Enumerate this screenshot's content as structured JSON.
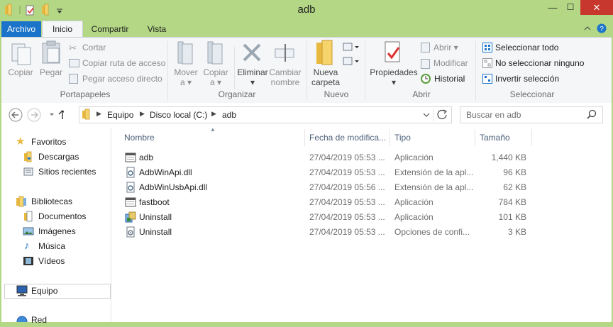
{
  "window": {
    "title": "adb",
    "minimize": "—",
    "close": "✕"
  },
  "tabs": {
    "archivo": "Archivo",
    "inicio": "Inicio",
    "compartir": "Compartir",
    "vista": "Vista"
  },
  "ribbon": {
    "portapapeles": {
      "label": "Portapapeles",
      "copiar": "Copiar",
      "pegar": "Pegar",
      "cortar": "Cortar",
      "copiar_ruta": "Copiar ruta de acceso",
      "pegar_acceso": "Pegar acceso directo"
    },
    "organizar": {
      "label": "Organizar",
      "mover_a": "Mover",
      "copiar_a": "Copiar",
      "a": "a",
      "eliminar": "Eliminar",
      "cambiar_nombre_1": "Cambiar",
      "cambiar_nombre_2": "nombre"
    },
    "nuevo": {
      "label": "Nuevo",
      "nueva_carpeta_1": "Nueva",
      "nueva_carpeta_2": "carpeta"
    },
    "abrir": {
      "label": "Abrir",
      "propiedades": "Propiedades",
      "abrir": "Abrir",
      "modificar": "Modificar",
      "historial": "Historial"
    },
    "seleccionar": {
      "label": "Seleccionar",
      "todo": "Seleccionar todo",
      "ninguno": "No seleccionar ninguno",
      "invertir": "Invertir selección"
    }
  },
  "address": {
    "crumbs": [
      "Equipo",
      "Disco local (C:)",
      "adb"
    ],
    "search_placeholder": "Buscar en adb"
  },
  "nav": {
    "favoritos": "Favoritos",
    "descargas": "Descargas",
    "sitios": "Sitios recientes",
    "bibliotecas": "Bibliotecas",
    "documentos": "Documentos",
    "imagenes": "Imágenes",
    "musica": "Música",
    "videos": "Vídeos",
    "equipo": "Equipo",
    "red": "Red"
  },
  "columns": {
    "nombre": "Nombre",
    "fecha": "Fecha de modifica...",
    "tipo": "Tipo",
    "tamano": "Tamaño"
  },
  "files": [
    {
      "name": "adb",
      "date": "27/04/2019 05:53 ...",
      "type": "Aplicación",
      "size": "1,440 KB",
      "icon": "exe"
    },
    {
      "name": "AdbWinApi.dll",
      "date": "27/04/2019 05:53 ...",
      "type": "Extensión de la apl...",
      "size": "96 KB",
      "icon": "dll"
    },
    {
      "name": "AdbWinUsbApi.dll",
      "date": "27/04/2019 05:56 ...",
      "type": "Extensión de la apl...",
      "size": "62 KB",
      "icon": "dll"
    },
    {
      "name": "fastboot",
      "date": "27/04/2019 05:53 ...",
      "type": "Aplicación",
      "size": "784 KB",
      "icon": "exe"
    },
    {
      "name": "Uninstall",
      "date": "27/04/2019 05:53 ...",
      "type": "Aplicación",
      "size": "101 KB",
      "icon": "setup"
    },
    {
      "name": "Uninstall",
      "date": "27/04/2019 05:53 ...",
      "type": "Opciones de confi...",
      "size": "3 KB",
      "icon": "ini"
    }
  ],
  "colors": {
    "titlebar": "#b3d785",
    "file_tab": "#1b74c9",
    "folder": "#e8b83f"
  }
}
